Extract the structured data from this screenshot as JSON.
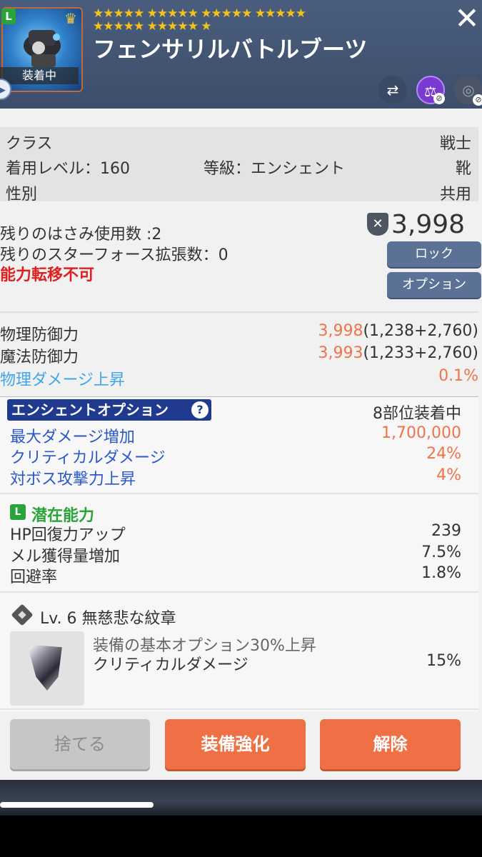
{
  "header": {
    "item_name": "フェンサリルバトルブーツ",
    "equipped_tag": "装着中",
    "legend_badge": "L",
    "stars_row1": "★★★★★ ★★★★★ ★★★★★ ★★★★★",
    "stars_row2": "★★★★★ ★★★★★ ★",
    "close_symbol": "✕"
  },
  "info": {
    "class_label": "クラス",
    "class_value": "戦士",
    "level_label": "着用レベル：160",
    "grade_label": "等級：エンシェント",
    "slot_value": "靴",
    "gender_label": "性別",
    "gender_value": "共用"
  },
  "usage": {
    "scissors": "残りのはさみ使用数 :2",
    "starforce": "残りのスターフォース拡張数：0",
    "transfer": "能力転移不可",
    "power": "3,998",
    "lock_button": "ロック",
    "option_button": "オプション"
  },
  "stats": [
    {
      "label": "物理防御力",
      "total": "3,998",
      "detail": "(1,238+2,760)"
    },
    {
      "label": "魔法防御力",
      "total": "3,993",
      "detail": "(1,233+2,760)"
    },
    {
      "label": "物理ダメージ上昇",
      "total": "0.1%",
      "detail": ""
    }
  ],
  "ancient": {
    "title": "エンシェントオプション",
    "help": "?",
    "set_status": "8部位装着中",
    "options": [
      {
        "label": "最大ダメージ増加",
        "value": "1,700,000"
      },
      {
        "label": "クリティカルダメージ",
        "value": "24%"
      },
      {
        "label": "対ボス攻撃力上昇",
        "value": "4%"
      }
    ]
  },
  "potential": {
    "badge": "L",
    "title": "潜在能力",
    "options": [
      {
        "label": "HP回復力アップ",
        "value": "239"
      },
      {
        "label": "メル獲得量増加",
        "value": "7.5%"
      },
      {
        "label": "回避率",
        "value": "1.8%"
      }
    ]
  },
  "emblem": {
    "title": "Lv. 6 無慈悲な紋章",
    "line1": "装備の基本オプション30%上昇",
    "stat_label": "クリティカルダメージ",
    "stat_value": "15%"
  },
  "buttons": {
    "discard": "捨てる",
    "enhance": "装備強化",
    "unequip": "解除"
  },
  "colors": {
    "header_bg": "#3c4e6b",
    "accent_orange": "#ee7044",
    "ancient_blue": "#1f3a8f",
    "potential_green": "#2aa43a"
  }
}
